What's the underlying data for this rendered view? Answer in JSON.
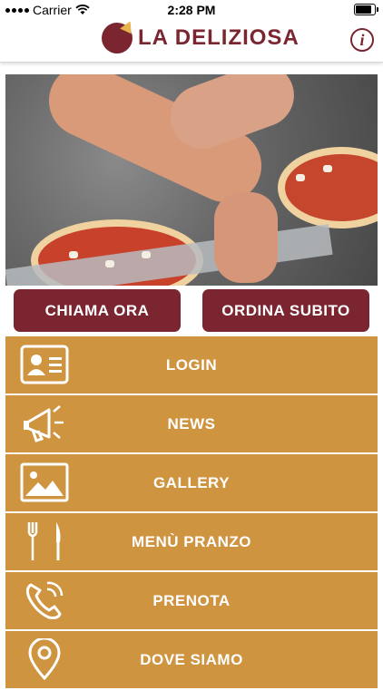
{
  "status": {
    "carrier": "Carrier",
    "time": "2:28 PM",
    "battery_level": 0.9
  },
  "header": {
    "logo_text": "LA DELIZIOSA",
    "info_glyph": "i",
    "brand_color": "#7a2530",
    "accent_color": "#cf9440"
  },
  "actions": {
    "call_label": "CHIAMA ORA",
    "order_label": "ORDINA SUBITO"
  },
  "menu": {
    "items": [
      {
        "label": "LOGIN",
        "icon": "contact-card-icon"
      },
      {
        "label": "NEWS",
        "icon": "megaphone-icon"
      },
      {
        "label": "GALLERY",
        "icon": "image-icon"
      },
      {
        "label": "MENÙ PRANZO",
        "icon": "fork-knife-icon"
      },
      {
        "label": "PRENOTA",
        "icon": "phone-icon"
      },
      {
        "label": "DOVE SIAMO",
        "icon": "location-pin-icon"
      }
    ]
  }
}
